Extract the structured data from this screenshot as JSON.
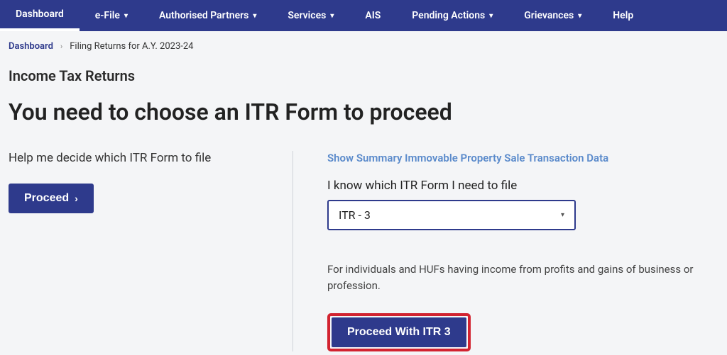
{
  "nav": {
    "items": [
      {
        "label": "Dashboard",
        "dropdown": false,
        "active": true
      },
      {
        "label": "e-File",
        "dropdown": true
      },
      {
        "label": "Authorised Partners",
        "dropdown": true
      },
      {
        "label": "Services",
        "dropdown": true
      },
      {
        "label": "AIS",
        "dropdown": false
      },
      {
        "label": "Pending Actions",
        "dropdown": true
      },
      {
        "label": "Grievances",
        "dropdown": true
      },
      {
        "label": "Help",
        "dropdown": false
      }
    ]
  },
  "breadcrumb": {
    "root": "Dashboard",
    "current": "Filing Returns for A.Y. 2023-24"
  },
  "section_label": "Income Tax Returns",
  "page_title": "You need to choose an ITR Form to proceed",
  "left": {
    "help_text": "Help me decide which ITR Form to file",
    "proceed_label": "Proceed"
  },
  "right": {
    "summary_link": "Show Summary Immovable Property Sale Transaction Data",
    "know_label": "I know which ITR Form I need to file",
    "select_value": "ITR - 3",
    "description": "For individuals and HUFs having income from profits and gains of business or profession.",
    "proceed_label": "Proceed With ITR 3"
  }
}
